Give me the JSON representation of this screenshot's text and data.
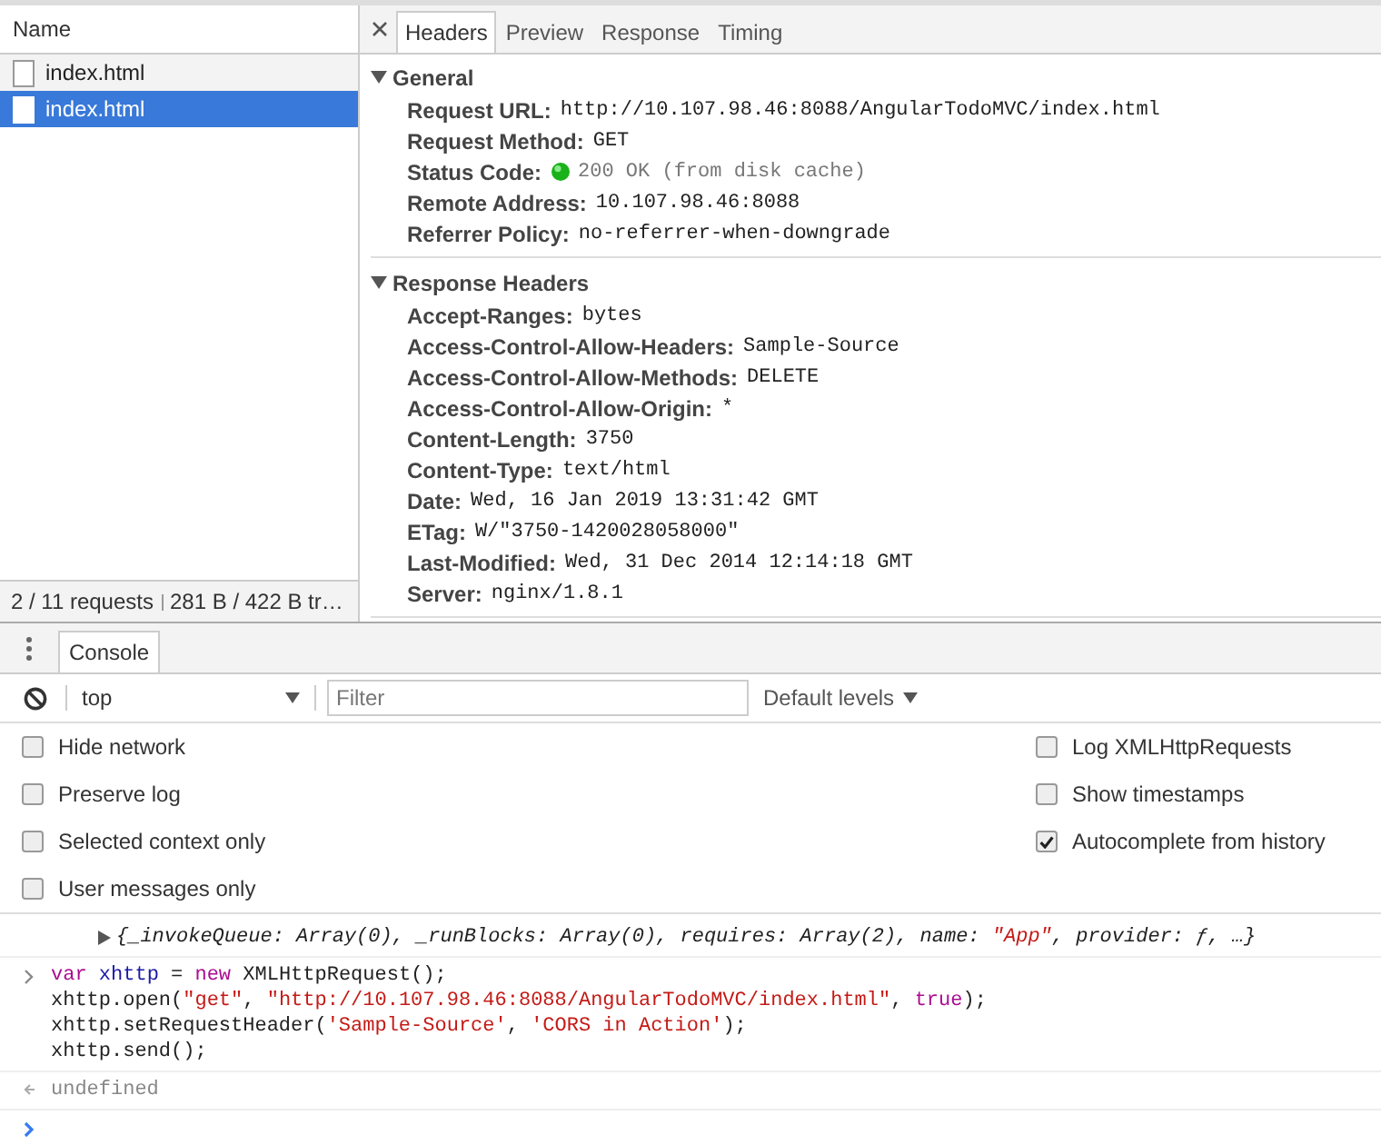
{
  "network": {
    "name_column": "Name",
    "requests": [
      {
        "name": "index.html",
        "selected": false
      },
      {
        "name": "index.html",
        "selected": true
      }
    ],
    "summary": "2 / 11 requests",
    "transfer": "281 B / 422 B tr…",
    "tabs": [
      {
        "label": "Headers",
        "selected": true
      },
      {
        "label": "Preview",
        "selected": false
      },
      {
        "label": "Response",
        "selected": false
      },
      {
        "label": "Timing",
        "selected": false
      }
    ],
    "sections": [
      {
        "title": "General",
        "expanded": true,
        "rows": [
          {
            "key": "Request URL:",
            "value": "http://10.107.98.46:8088/AngularTodoMVC/index.html",
            "kind": "plain"
          },
          {
            "key": "Request Method:",
            "value": "GET",
            "kind": "plain"
          },
          {
            "key": "Status Code:",
            "value": "200 OK (from disk cache)",
            "kind": "status"
          },
          {
            "key": "Remote Address:",
            "value": "10.107.98.46:8088",
            "kind": "plain"
          },
          {
            "key": "Referrer Policy:",
            "value": "no-referrer-when-downgrade",
            "kind": "plain"
          }
        ]
      },
      {
        "title": "Response Headers",
        "expanded": true,
        "rows": [
          {
            "key": "Accept-Ranges:",
            "value": "bytes",
            "kind": "plain"
          },
          {
            "key": "Access-Control-Allow-Headers:",
            "value": "Sample-Source",
            "kind": "plain"
          },
          {
            "key": "Access-Control-Allow-Methods:",
            "value": "DELETE",
            "kind": "plain"
          },
          {
            "key": "Access-Control-Allow-Origin:",
            "value": "*",
            "kind": "plain"
          },
          {
            "key": "Content-Length:",
            "value": "3750",
            "kind": "plain"
          },
          {
            "key": "Content-Type:",
            "value": "text/html",
            "kind": "plain"
          },
          {
            "key": "Date:",
            "value": "Wed, 16 Jan 2019 13:31:42 GMT",
            "kind": "plain"
          },
          {
            "key": "ETag:",
            "value": "W/\"3750-1420028058000\"",
            "kind": "plain"
          },
          {
            "key": "Last-Modified:",
            "value": "Wed, 31 Dec 2014 12:14:18 GMT",
            "kind": "plain"
          },
          {
            "key": "Server:",
            "value": "nginx/1.8.1",
            "kind": "plain"
          }
        ]
      }
    ]
  },
  "console": {
    "tabs": [
      {
        "label": "Console",
        "selected": true
      }
    ],
    "context": "top",
    "filter_placeholder": "Filter",
    "levels": "Default levels",
    "settings_left": [
      {
        "label": "Hide network",
        "checked": false
      },
      {
        "label": "Preserve log",
        "checked": false
      },
      {
        "label": "Selected context only",
        "checked": false
      },
      {
        "label": "User messages only",
        "checked": false
      }
    ],
    "settings_right": [
      {
        "label": "Log XMLHttpRequests",
        "checked": false
      },
      {
        "label": "Show timestamps",
        "checked": false
      },
      {
        "label": "Autocomplete from history",
        "checked": true
      }
    ],
    "messages": [
      {
        "kind": "object",
        "lines": [
          [
            {
              "text": "{_invokeQueue: Array(0), _runBlocks: Array(0), requires: Array(2), name: ",
              "kind": "plain"
            },
            {
              "text": "\"App\"",
              "kind": "string"
            },
            {
              "text": ", provider: ƒ, …}",
              "kind": "plain"
            }
          ]
        ]
      },
      {
        "kind": "input",
        "lines": [
          [
            {
              "text": "var",
              "kind": "keyword"
            },
            {
              "text": " xhttp",
              "kind": "definition"
            },
            {
              "text": " = ",
              "kind": "plain"
            },
            {
              "text": "new",
              "kind": "keyword"
            },
            {
              "text": " XMLHttpRequest();",
              "kind": "plain"
            }
          ],
          [
            {
              "text": "xhttp.open(",
              "kind": "plain"
            },
            {
              "text": "\"get\"",
              "kind": "string"
            },
            {
              "text": ", ",
              "kind": "plain"
            },
            {
              "text": "\"http://10.107.98.46:8088/AngularTodoMVC/index.html\"",
              "kind": "string"
            },
            {
              "text": ", ",
              "kind": "plain"
            },
            {
              "text": "true",
              "kind": "keyword"
            },
            {
              "text": ");",
              "kind": "plain"
            }
          ],
          [
            {
              "text": "xhttp.setRequestHeader(",
              "kind": "plain"
            },
            {
              "text": "'Sample-Source'",
              "kind": "string"
            },
            {
              "text": ", ",
              "kind": "plain"
            },
            {
              "text": "'CORS in Action'",
              "kind": "string"
            },
            {
              "text": ");",
              "kind": "plain"
            }
          ],
          [
            {
              "text": "xhttp.send();",
              "kind": "plain"
            }
          ]
        ]
      },
      {
        "kind": "result",
        "lines": [
          [
            {
              "text": "undefined",
              "kind": "plain"
            }
          ]
        ]
      },
      {
        "kind": "prompt"
      }
    ]
  }
}
